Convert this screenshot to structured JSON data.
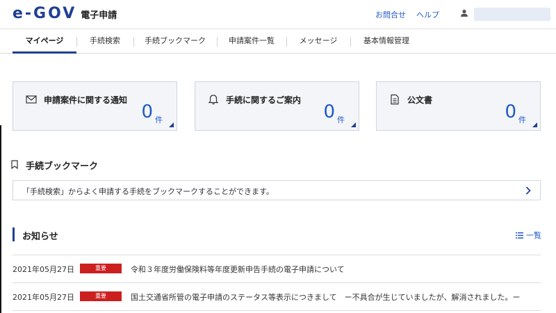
{
  "header": {
    "logo_mark": "e-GOV",
    "logo_sub": "電子申請",
    "contact": "お問合せ",
    "help": "ヘルプ"
  },
  "nav": {
    "items": [
      {
        "label": "マイページ",
        "active": true
      },
      {
        "label": "手続検索"
      },
      {
        "label": "手続ブックマーク"
      },
      {
        "label": "申請案件一覧"
      },
      {
        "label": "メッセージ"
      },
      {
        "label": "基本情報管理"
      }
    ]
  },
  "cards": [
    {
      "title": "申請案件に関する通知",
      "count": "0",
      "unit": "件",
      "icon": "mail-icon"
    },
    {
      "title": "手続に関するご案内",
      "count": "0",
      "unit": "件",
      "icon": "bell-icon"
    },
    {
      "title": "公文書",
      "count": "0",
      "unit": "件",
      "icon": "document-icon"
    }
  ],
  "bookmark": {
    "title": "手続ブックマーク",
    "message": "「手続検索」からよく申請する手続をブックマークすることができます。"
  },
  "news": {
    "title": "お知らせ",
    "list_link": "一覧",
    "items": [
      {
        "date": "2021年05月27日",
        "badge": "重要",
        "text": "令和３年度労働保険料等年度更新申告手続の電子申請について"
      },
      {
        "date": "2021年05月27日",
        "badge": "重要",
        "text": "国土交通省所管の電子申請のステータス等表示につきまして　ー不具合が生じていましたが、解消されました。ー"
      }
    ]
  },
  "colors": {
    "brand": "#1f3f95",
    "link": "#1f58c8",
    "badge": "#cc1f1f"
  }
}
